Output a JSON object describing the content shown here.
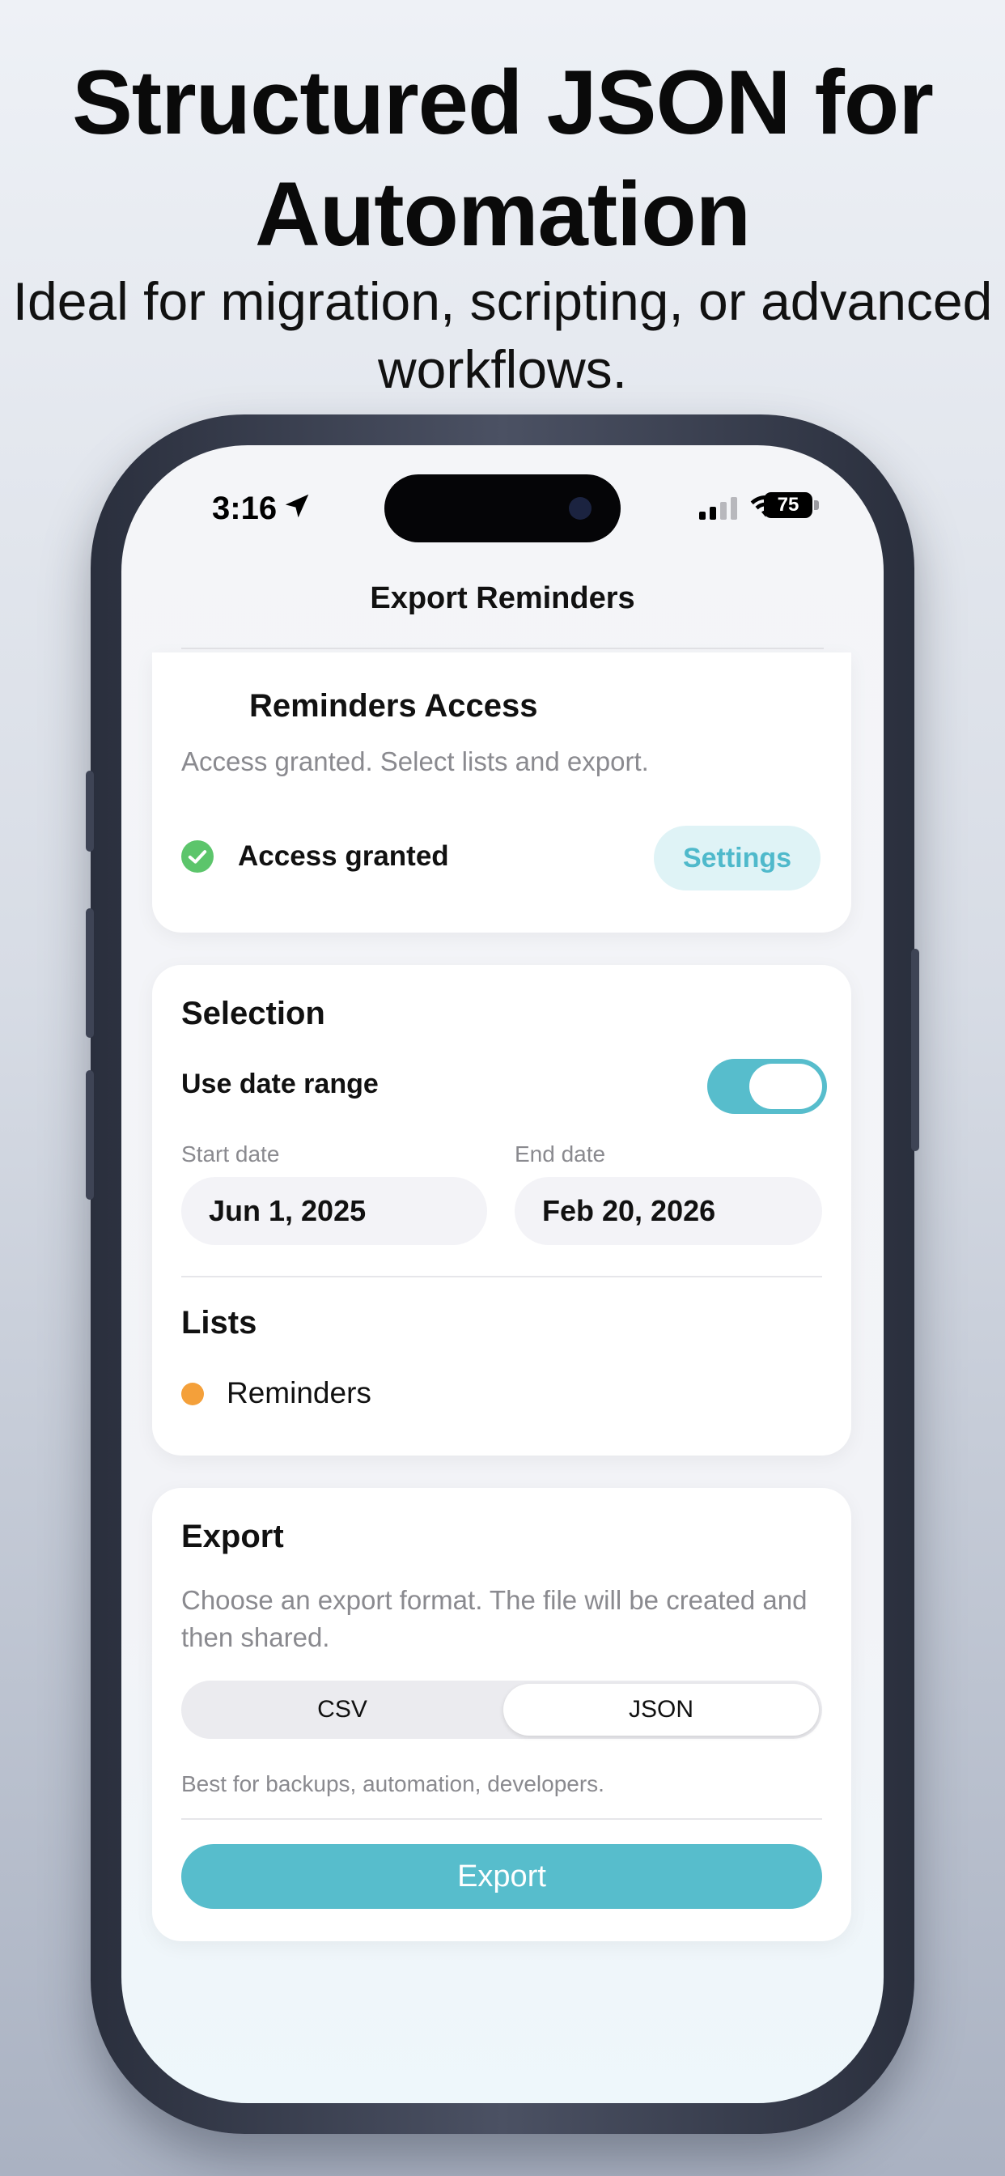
{
  "promo": {
    "headline": "Structured JSON for Automation",
    "subhead": "Ideal for migration, scripting, or advanced workflows."
  },
  "status_bar": {
    "time": "3:16",
    "battery": "75",
    "icons": [
      "location-arrow-icon",
      "cellular-signal-icon",
      "wifi-icon",
      "battery-icon"
    ]
  },
  "nav": {
    "title": "Export Reminders"
  },
  "access_card": {
    "title": "Reminders Access",
    "description": "Access granted. Select lists and export.",
    "status_label": "Access granted",
    "status_icon": "checkmark-circle-icon",
    "status_color": "#5cc56b",
    "settings_button": "Settings"
  },
  "selection_card": {
    "title": "Selection",
    "date_range_label": "Use date range",
    "date_range_enabled": true,
    "start_label": "Start date",
    "start_value": "Jun 1, 2025",
    "end_label": "End date",
    "end_value": "Feb 20, 2026",
    "lists_title": "Lists",
    "lists": [
      {
        "name": "Reminders",
        "color": "#f4a03a"
      }
    ]
  },
  "export_card": {
    "title": "Export",
    "description": "Choose an export format. The file will be created and then shared.",
    "formats": [
      "CSV",
      "JSON"
    ],
    "selected_format": "JSON",
    "format_hint": "Best for backups, automation, developers.",
    "export_button": "Export"
  },
  "colors": {
    "accent": "#57bdcc",
    "accent_soft": "#dff3f6",
    "success": "#5cc56b",
    "list_orange": "#f4a03a"
  }
}
